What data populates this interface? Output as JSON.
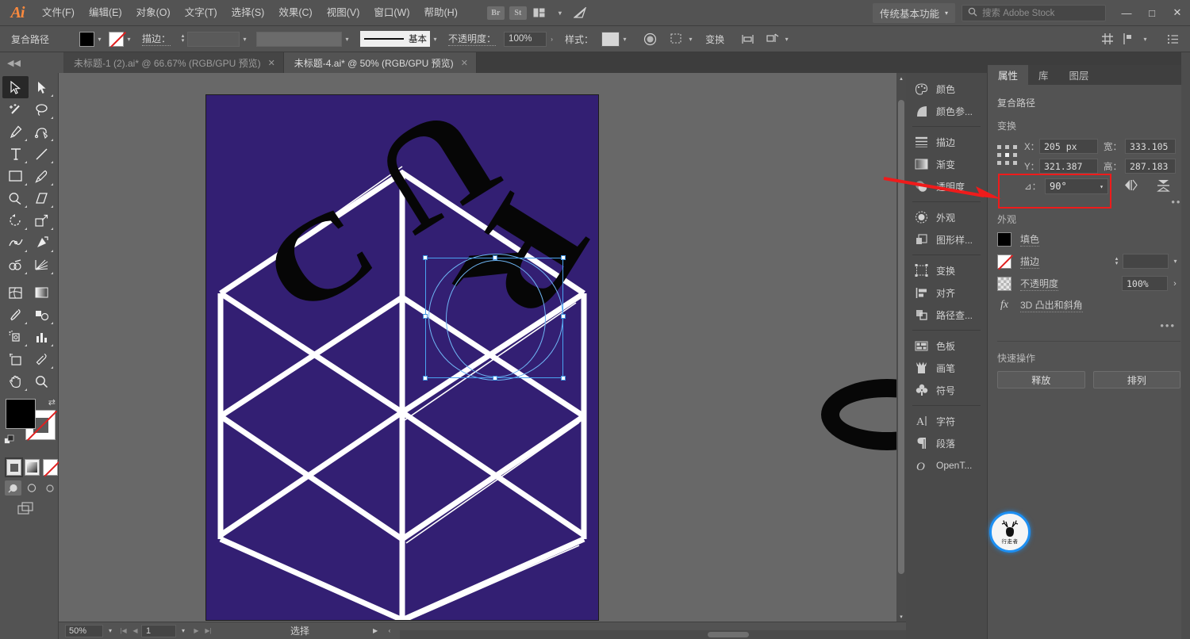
{
  "app": {
    "name": "Ai",
    "logo_text": "Ai"
  },
  "menubar": {
    "items": [
      {
        "label": "文件(F)"
      },
      {
        "label": "编辑(E)"
      },
      {
        "label": "对象(O)"
      },
      {
        "label": "文字(T)"
      },
      {
        "label": "选择(S)"
      },
      {
        "label": "效果(C)"
      },
      {
        "label": "视图(V)"
      },
      {
        "label": "窗口(W)"
      },
      {
        "label": "帮助(H)"
      }
    ],
    "bridge_label": "Br",
    "stock_label": "St",
    "workspace": "传统基本功能",
    "search_placeholder": "搜索 Adobe Stock",
    "minimize": "—",
    "maximize": "□",
    "close": "✕"
  },
  "controlbar": {
    "object_label": "复合路径",
    "fill_color": "#000000",
    "stroke_label": "描边：",
    "stroke_weight": "",
    "stroke_profile": "",
    "brush_label": "基本",
    "opacity_label": "不透明度：",
    "opacity_value": "100%",
    "style_label": "样式：",
    "transform_label": "变换",
    "align_label": "",
    "arrange_label": ""
  },
  "tabs": [
    {
      "label": "未标题-1 (2).ai* @ 66.67% (RGB/GPU 预览)",
      "active": false,
      "close": "✕"
    },
    {
      "label": "未标题-4.ai* @ 50% (RGB/GPU 预览)",
      "active": true,
      "close": "✕"
    }
  ],
  "toolbar": {
    "tools": [
      {
        "name": "selection-tool",
        "selected": true
      },
      {
        "name": "direct-selection-tool",
        "selected": false
      },
      {
        "name": "magic-wand-tool",
        "selected": false
      },
      {
        "name": "lasso-tool",
        "selected": false
      },
      {
        "name": "pen-tool",
        "selected": false
      },
      {
        "name": "curvature-tool",
        "selected": false
      },
      {
        "name": "type-tool",
        "selected": false
      },
      {
        "name": "line-segment-tool",
        "selected": false
      },
      {
        "name": "rectangle-tool",
        "selected": false
      },
      {
        "name": "paintbrush-tool",
        "selected": false
      },
      {
        "name": "shaper-tool",
        "selected": false
      },
      {
        "name": "eraser-tool",
        "selected": false
      },
      {
        "name": "rotate-tool",
        "selected": false
      },
      {
        "name": "scale-tool",
        "selected": false
      },
      {
        "name": "width-tool",
        "selected": false
      },
      {
        "name": "free-transform-tool",
        "selected": false
      },
      {
        "name": "shape-builder-tool",
        "selected": false
      },
      {
        "name": "perspective-grid-tool",
        "selected": false
      },
      {
        "name": "mesh-tool",
        "selected": false
      },
      {
        "name": "gradient-tool",
        "selected": false
      },
      {
        "name": "eyedropper-tool",
        "selected": false
      },
      {
        "name": "blend-tool",
        "selected": false
      },
      {
        "name": "symbol-sprayer-tool",
        "selected": false
      },
      {
        "name": "column-graph-tool",
        "selected": false
      },
      {
        "name": "artboard-tool",
        "selected": false
      },
      {
        "name": "slice-tool",
        "selected": false
      },
      {
        "name": "hand-tool",
        "selected": false
      },
      {
        "name": "zoom-tool",
        "selected": false
      }
    ],
    "fill_color": "#000000",
    "stroke_color": "none",
    "color_modes": [
      "color",
      "gradient",
      "none"
    ],
    "draw_modes": [
      "draw-normal",
      "draw-behind",
      "draw-inside"
    ]
  },
  "canvas": {
    "artboard_bg": "#331f73",
    "grid_color": "#ffffff",
    "letters": [
      {
        "char": "C",
        "name": "letter-c"
      },
      {
        "char": "U",
        "name": "letter-u"
      },
      {
        "char": "R",
        "name": "letter-r"
      },
      {
        "char": "O",
        "name": "letter-o-detached"
      }
    ],
    "selection_color": "#4aa3f0"
  },
  "statusbar": {
    "zoom": "50%",
    "page": "1",
    "status_text": "选择"
  },
  "dock": {
    "groups": [
      {
        "items": [
          {
            "label": "颜色",
            "icon": "palette-icon"
          },
          {
            "label": "颜色参...",
            "icon": "color-guide-icon"
          }
        ]
      },
      {
        "items": [
          {
            "label": "描边",
            "icon": "stroke-icon"
          },
          {
            "label": "渐变",
            "icon": "gradient-icon"
          },
          {
            "label": "透明度",
            "icon": "transparency-icon"
          }
        ]
      },
      {
        "items": [
          {
            "label": "外观",
            "icon": "appearance-icon"
          },
          {
            "label": "图形样...",
            "icon": "graphic-styles-icon"
          }
        ]
      },
      {
        "items": [
          {
            "label": "变换",
            "icon": "transform-icon"
          },
          {
            "label": "对齐",
            "icon": "align-icon"
          },
          {
            "label": "路径查...",
            "icon": "pathfinder-icon"
          }
        ]
      },
      {
        "items": [
          {
            "label": "色板",
            "icon": "swatches-icon"
          },
          {
            "label": "画笔",
            "icon": "brushes-icon"
          },
          {
            "label": "符号",
            "icon": "symbols-icon"
          }
        ]
      },
      {
        "items": [
          {
            "label": "字符",
            "icon": "character-icon"
          },
          {
            "label": "段落",
            "icon": "paragraph-icon"
          },
          {
            "label": "OpenT...",
            "icon": "opentype-icon"
          }
        ]
      }
    ]
  },
  "properties": {
    "tabs": [
      {
        "label": "属性",
        "active": true
      },
      {
        "label": "库",
        "active": false
      },
      {
        "label": "图层",
        "active": false
      }
    ],
    "object_type": "复合路径",
    "transform": {
      "title": "变换",
      "x_label": "X：",
      "x_value": "205 px",
      "y_label": "Y：",
      "y_value": "321.387",
      "w_label": "宽：",
      "w_value": "333.105",
      "h_label": "高：",
      "h_value": "287.183",
      "angle_label": "⊿：",
      "angle_value": "90°"
    },
    "appearance": {
      "title": "外观",
      "fill_label": "填色",
      "fill_color": "#000000",
      "stroke_label": "描边",
      "stroke_value": "",
      "opacity_label": "不透明度",
      "opacity_value": "100%",
      "effect_label": "3D 凸出和斜角",
      "effect_prefix": "fx"
    },
    "quick_actions": {
      "title": "快速操作",
      "buttons": [
        {
          "label": "释放"
        },
        {
          "label": "排列"
        }
      ]
    },
    "more": "•••"
  },
  "annotation": {
    "highlight_color": "#ef1b1b",
    "arrow_color": "#ef1b1b"
  },
  "badge": {
    "text": "行走者"
  }
}
